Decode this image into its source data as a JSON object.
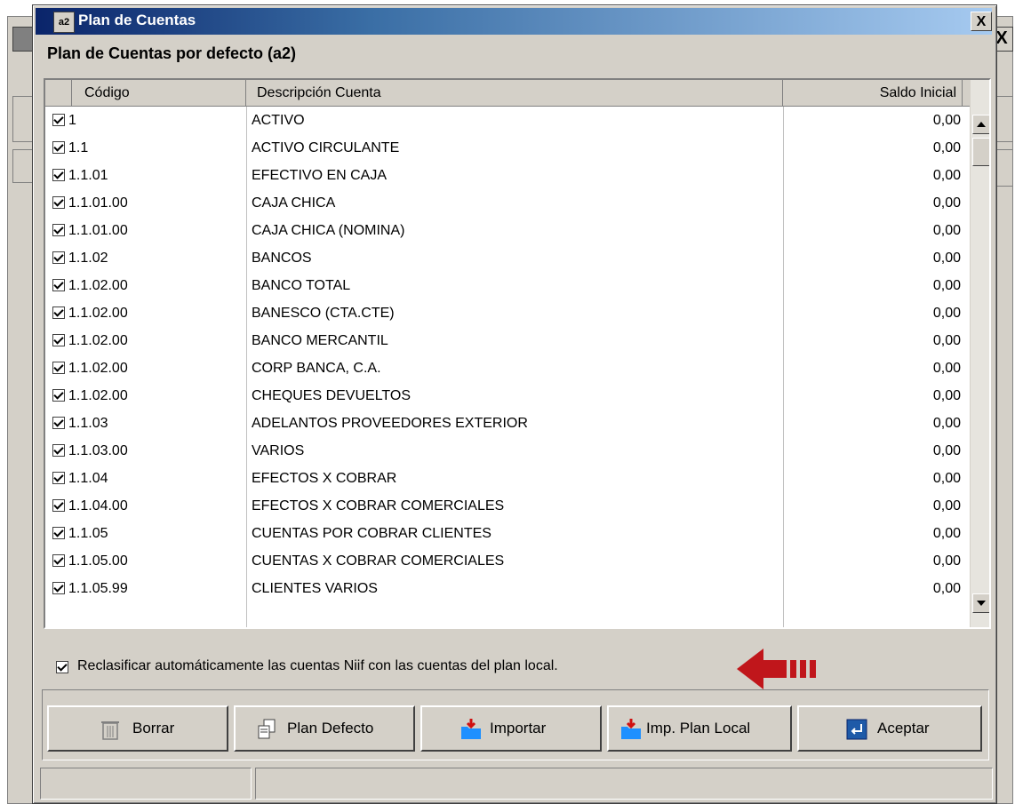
{
  "window": {
    "title": "Plan de Cuentas",
    "icon_text": "a2",
    "close_label": "X"
  },
  "subtitle": "Plan de Cuentas por defecto (a2)",
  "table": {
    "columns": [
      "Código",
      "Descripción Cuenta",
      "Saldo Inicial"
    ],
    "rows": [
      {
        "codigo": "1",
        "descripcion": "ACTIVO",
        "saldo": "0,00",
        "checked": true
      },
      {
        "codigo": "1.1",
        "descripcion": "ACTIVO CIRCULANTE",
        "saldo": "0,00",
        "checked": true
      },
      {
        "codigo": "1.1.01",
        "descripcion": "EFECTIVO EN CAJA",
        "saldo": "0,00",
        "checked": true
      },
      {
        "codigo": "1.1.01.00",
        "descripcion": "CAJA CHICA",
        "saldo": "0,00",
        "checked": true
      },
      {
        "codigo": "1.1.01.00",
        "descripcion": "CAJA CHICA (NOMINA)",
        "saldo": "0,00",
        "checked": true
      },
      {
        "codigo": "1.1.02",
        "descripcion": "BANCOS",
        "saldo": "0,00",
        "checked": true
      },
      {
        "codigo": "1.1.02.00",
        "descripcion": "BANCO TOTAL",
        "saldo": "0,00",
        "checked": true
      },
      {
        "codigo": "1.1.02.00",
        "descripcion": "BANESCO (CTA.CTE)",
        "saldo": "0,00",
        "checked": true
      },
      {
        "codigo": "1.1.02.00",
        "descripcion": "BANCO MERCANTIL",
        "saldo": "0,00",
        "checked": true
      },
      {
        "codigo": "1.1.02.00",
        "descripcion": "CORP BANCA, C.A.",
        "saldo": "0,00",
        "checked": true
      },
      {
        "codigo": "1.1.02.00",
        "descripcion": "CHEQUES DEVUELTOS",
        "saldo": "0,00",
        "checked": true
      },
      {
        "codigo": "1.1.03",
        "descripcion": "ADELANTOS PROVEEDORES EXTERIOR",
        "saldo": "0,00",
        "checked": true
      },
      {
        "codigo": "1.1.03.00",
        "descripcion": "VARIOS",
        "saldo": "0,00",
        "checked": true
      },
      {
        "codigo": "1.1.04",
        "descripcion": "EFECTOS X COBRAR",
        "saldo": "0,00",
        "checked": true
      },
      {
        "codigo": "1.1.04.00",
        "descripcion": "EFECTOS X COBRAR COMERCIALES",
        "saldo": "0,00",
        "checked": true
      },
      {
        "codigo": "1.1.05",
        "descripcion": "CUENTAS POR COBRAR CLIENTES",
        "saldo": "0,00",
        "checked": true
      },
      {
        "codigo": "1.1.05.00",
        "descripcion": "CUENTAS X COBRAR COMERCIALES",
        "saldo": "0,00",
        "checked": true
      },
      {
        "codigo": "1.1.05.99",
        "descripcion": "CLIENTES VARIOS",
        "saldo": "0,00",
        "checked": true
      }
    ]
  },
  "reclassify": {
    "label": "Reclasificar automáticamente las cuentas Niif con las cuentas del plan local.",
    "checked": true
  },
  "buttons": {
    "borrar": "Borrar",
    "plan_defecto": "Plan Defecto",
    "importar": "Importar",
    "imp_plan_local": "Imp. Plan Local",
    "aceptar": "Aceptar"
  },
  "colors": {
    "title_start": "#0a246a",
    "title_end": "#a6caf0",
    "face": "#d4d0c8",
    "arrow": "#c0161b"
  },
  "icons": {
    "window": "app-icon",
    "borrar": "trash-icon",
    "plan_defecto": "copy-documents-icon",
    "importar": "import-folder-icon",
    "imp_plan_local": "import-folder-icon",
    "aceptar": "enter-icon"
  }
}
